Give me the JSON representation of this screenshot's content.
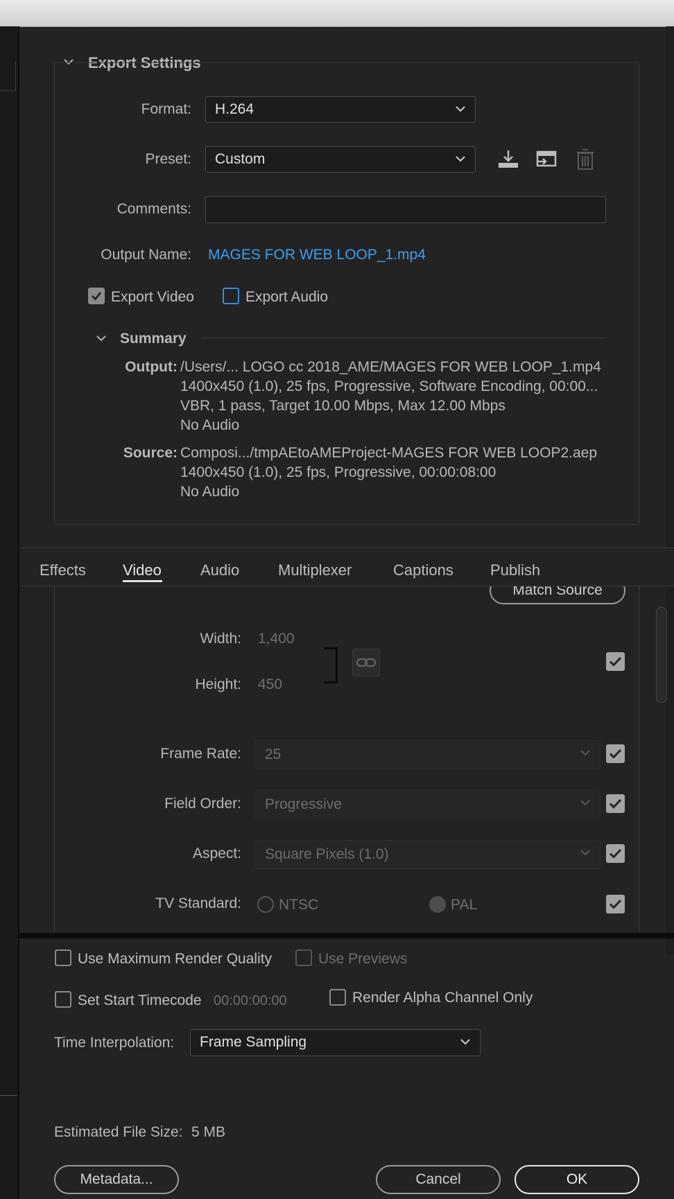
{
  "export_settings": {
    "heading": "Export Settings",
    "format_label": "Format:",
    "format_value": "H.264",
    "preset_label": "Preset:",
    "preset_value": "Custom",
    "comments_label": "Comments:",
    "comments_value": "",
    "output_name_label": "Output Name:",
    "output_name_value": "MAGES FOR WEB LOOP_1.mp4",
    "export_video_label": "Export Video",
    "export_video_checked": true,
    "export_audio_label": "Export Audio",
    "export_audio_checked": false
  },
  "summary": {
    "heading": "Summary",
    "output_label": "Output:",
    "output_lines": [
      "/Users/... LOGO cc 2018_AME/MAGES FOR WEB LOOP_1.mp4",
      "1400x450 (1.0), 25 fps, Progressive, Software Encoding, 00:00...",
      "VBR, 1 pass, Target 10.00 Mbps, Max 12.00 Mbps",
      "No Audio"
    ],
    "source_label": "Source:",
    "source_lines": [
      "Composi.../tmpAEtoAMEProject-MAGES FOR WEB LOOP2.aep",
      "1400x450 (1.0), 25 fps, Progressive, 00:00:08:00",
      "No Audio"
    ]
  },
  "tabs": [
    "Effects",
    "Video",
    "Audio",
    "Multiplexer",
    "Captions",
    "Publish"
  ],
  "active_tab": "Video",
  "video": {
    "match_source_label": "Match Source",
    "width_label": "Width:",
    "width_value": "1,400",
    "height_label": "Height:",
    "height_value": "450",
    "frame_rate_label": "Frame Rate:",
    "frame_rate_value": "25",
    "field_order_label": "Field Order:",
    "field_order_value": "Progressive",
    "aspect_label": "Aspect:",
    "aspect_value": "Square Pixels (1.0)",
    "tv_standard_label": "TV Standard:",
    "ntsc_label": "NTSC",
    "pal_label": "PAL",
    "selected_tv_standard": "PAL"
  },
  "bottom": {
    "max_render_quality_label": "Use Maximum Render Quality",
    "use_previews_label": "Use Previews",
    "set_start_timecode_label": "Set Start Timecode",
    "start_timecode_value": "00:00:00:00",
    "render_alpha_label": "Render Alpha Channel Only",
    "time_interpolation_label": "Time Interpolation:",
    "time_interpolation_value": "Frame Sampling",
    "estimated_size_label": "Estimated File Size:",
    "estimated_size_value": "5 MB",
    "metadata_button": "Metadata...",
    "cancel_button": "Cancel",
    "ok_button": "OK"
  },
  "colors": {
    "background": "#232323",
    "link": "#3aa0f0",
    "focus_outline": "#2d8ceb"
  },
  "icons": [
    "chevron-down-icon",
    "save-preset-icon",
    "import-preset-icon",
    "delete-preset-icon",
    "link-icon",
    "checkmark-icon"
  ]
}
